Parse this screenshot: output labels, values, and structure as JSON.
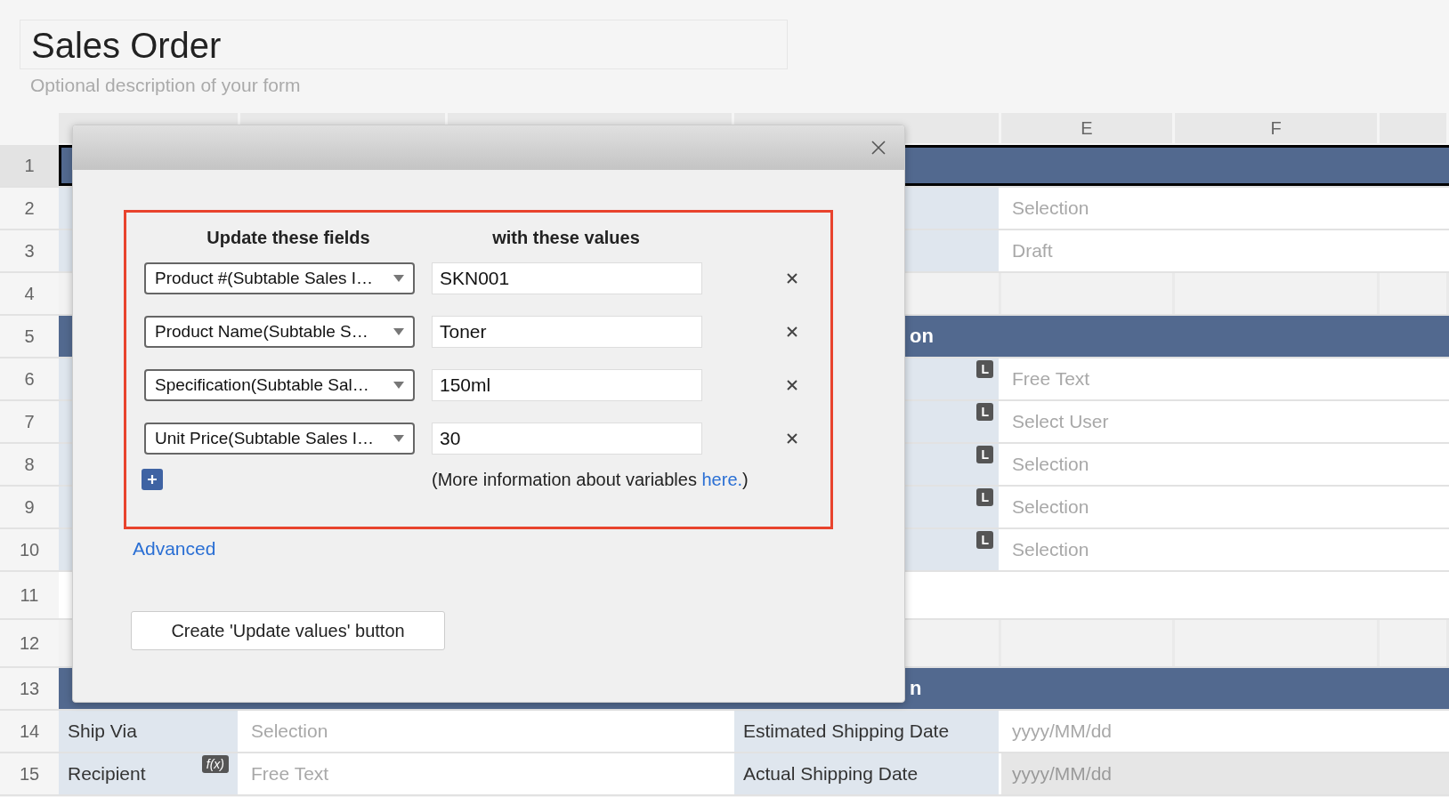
{
  "form": {
    "title": "Sales Order",
    "description": "Optional description of your form"
  },
  "column_headers": [
    {
      "label": "E"
    },
    {
      "label": "F"
    }
  ],
  "rows": [
    {
      "number": "1",
      "kind": "section",
      "selected": true
    },
    {
      "number": "2",
      "kind": "field",
      "placeholder": "Selection",
      "selected": false
    },
    {
      "number": "3",
      "kind": "field",
      "placeholder": "Draft",
      "selected": false
    },
    {
      "number": "4",
      "kind": "empty",
      "selected": false
    },
    {
      "number": "5",
      "kind": "section",
      "text": "on",
      "selected": false
    },
    {
      "number": "6",
      "kind": "field",
      "badge": "L",
      "placeholder": "Free Text",
      "selected": false
    },
    {
      "number": "7",
      "kind": "field",
      "badge": "L",
      "placeholder": "Select User",
      "selected": false
    },
    {
      "number": "8",
      "kind": "field",
      "badge": "L",
      "placeholder": "Selection",
      "selected": false
    },
    {
      "number": "9",
      "kind": "field",
      "badge": "L",
      "placeholder": "Selection",
      "selected": false
    },
    {
      "number": "10",
      "kind": "field",
      "badge": "L",
      "placeholder": "Selection",
      "selected": false
    },
    {
      "number": "11",
      "kind": "blank",
      "selected": false
    },
    {
      "number": "12",
      "kind": "empty",
      "selected": false
    },
    {
      "number": "13",
      "kind": "section",
      "text": "n",
      "selected": false
    },
    {
      "number": "14",
      "kind": "full",
      "label": "Ship Via",
      "placeholder": "Selection",
      "label2": "Estimated Shipping Date",
      "placeholder2": "yyyy/MM/dd",
      "disabled": false,
      "selected": false
    },
    {
      "number": "15",
      "kind": "full",
      "label": "Recipient",
      "badge": "f(x)",
      "placeholder": "Free Text",
      "label2": "Actual Shipping Date",
      "placeholder2": "yyyy/MM/dd",
      "disabled": true,
      "selected": false
    }
  ],
  "dialog": {
    "headers": [
      "Update these fields",
      "with these values"
    ],
    "rules": [
      {
        "field": "Product #(Subtable Sales I…",
        "value": "SKN001"
      },
      {
        "field": "Product Name(Subtable S…",
        "value": "Toner"
      },
      {
        "field": "Specification(Subtable Sal…",
        "value": "150ml"
      },
      {
        "field": "Unit Price(Subtable Sales I…",
        "value": "30"
      }
    ],
    "note_before": "(More information about variables ",
    "note_link": "here.",
    "note_after": ")",
    "advanced_link": "Advanced",
    "create_button": "Create 'Update values' button"
  }
}
